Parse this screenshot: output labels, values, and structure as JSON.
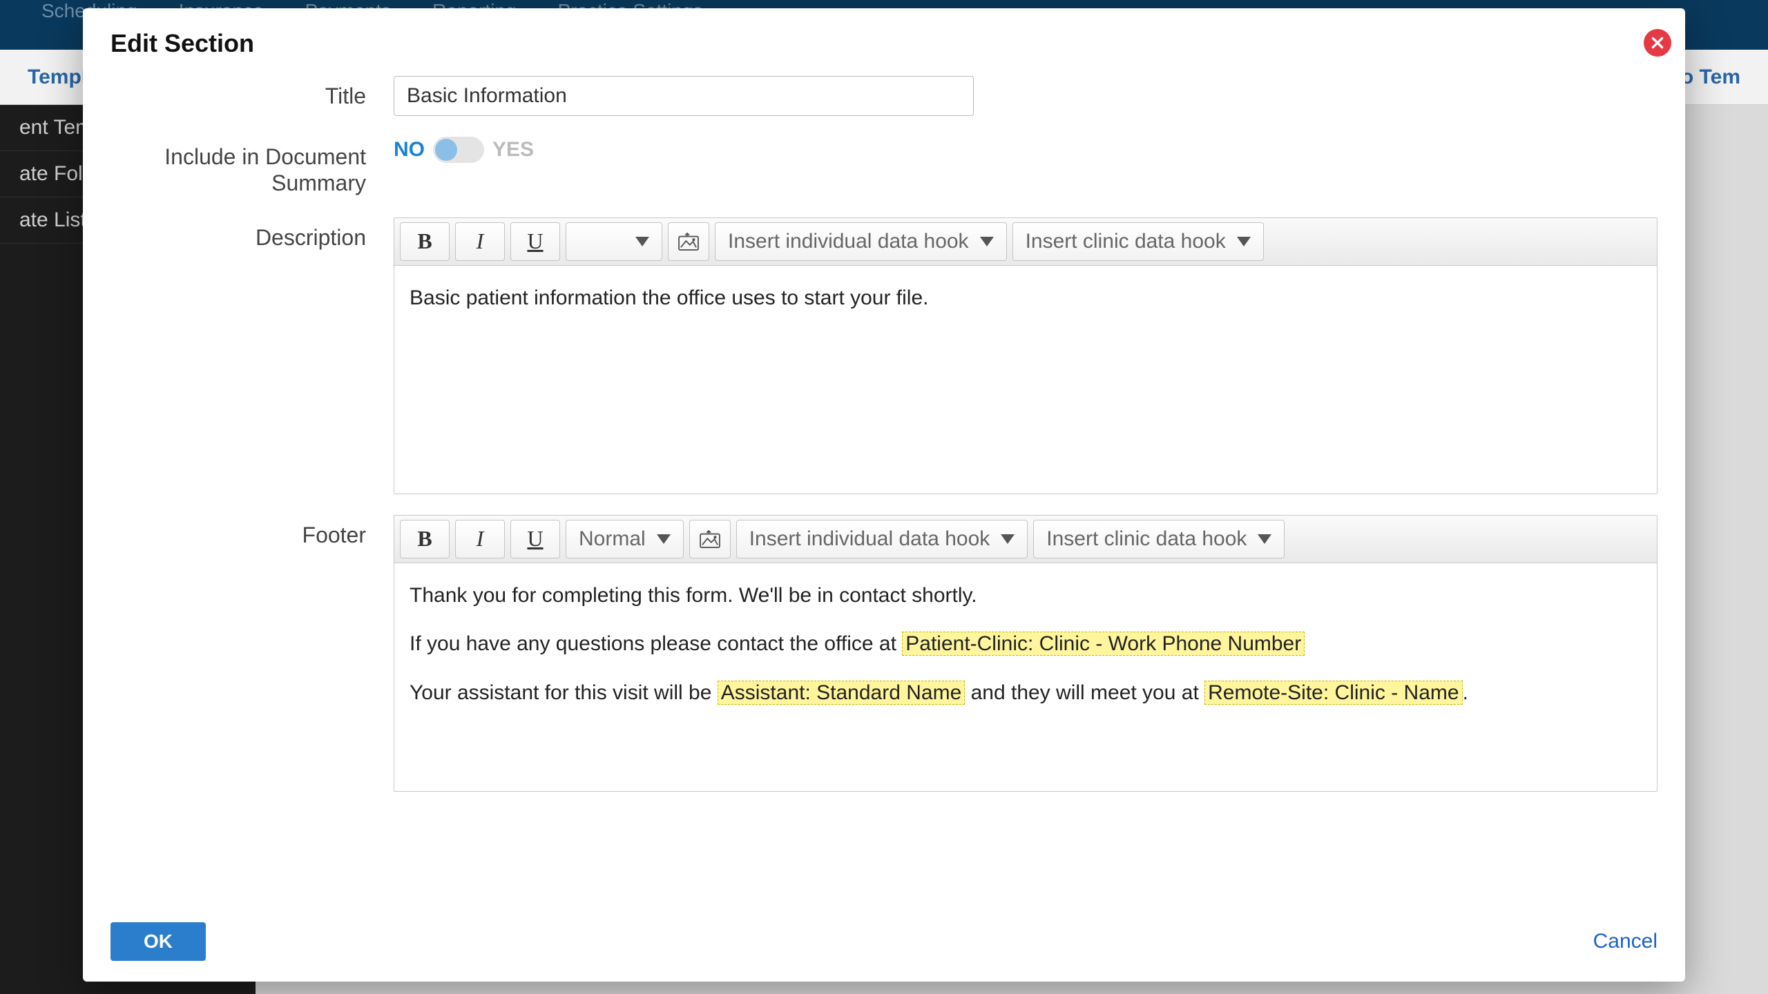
{
  "background": {
    "nav": [
      "Scheduling",
      "Insurance",
      "Payments",
      "Reporting",
      "Practice Settings"
    ],
    "subhead_left": "Templates",
    "subhead_right": "ck to Tem",
    "sidebar": [
      "ent Temp",
      "ate Folde",
      "ate List"
    ]
  },
  "modal": {
    "heading": "Edit Section",
    "labels": {
      "title": "Title",
      "include": "Include in Document Summary",
      "description": "Description",
      "footer": "Footer"
    },
    "title_value": "Basic Information",
    "toggle": {
      "no": "NO",
      "yes": "YES",
      "state": "no"
    },
    "toolbar": {
      "bold": "B",
      "italic": "I",
      "underline": "U",
      "normal": "Normal",
      "individual_hook": "Insert individual data hook",
      "clinic_hook": "Insert clinic data hook"
    },
    "description_body": "Basic patient information the office uses to start your file.",
    "footer_body": {
      "p1": "Thank you for completing this form. We'll be in contact shortly.",
      "p2_pre": "If you have any questions please contact the office at ",
      "p2_hook": "Patient-Clinic: Clinic - Work Phone Number",
      "p3_pre": "Your assistant for this visit will be ",
      "p3_hook1": "Assistant: Standard Name",
      "p3_mid": " and they will meet you at ",
      "p3_hook2": "Remote-Site: Clinic - Name",
      "p3_post": "."
    },
    "actions": {
      "ok": "OK",
      "cancel": "Cancel"
    }
  }
}
